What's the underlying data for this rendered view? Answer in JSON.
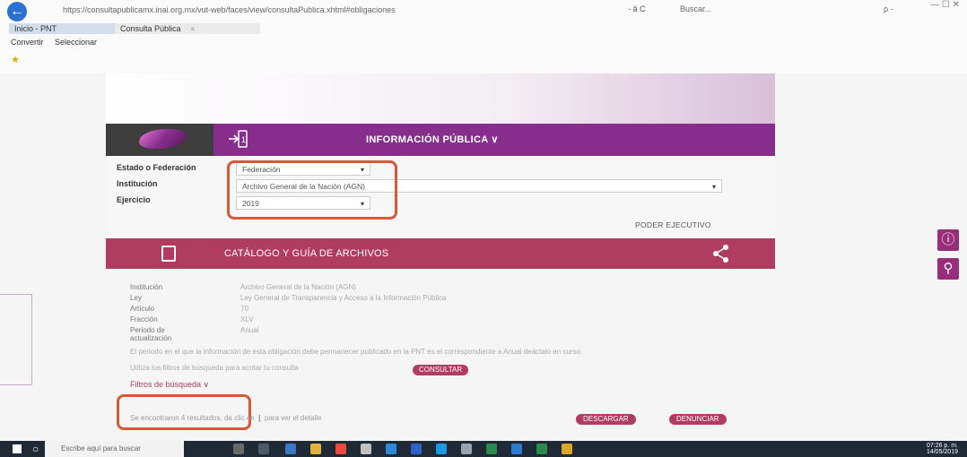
{
  "browser": {
    "back_icon": "back-arrow-icon",
    "url": "https://consultapublicamx.inai.org.mx/vut-web/faces/view/consultaPublica.xhtml#obligaciones",
    "url_tools": "- â C",
    "search_placeholder": "Buscar...",
    "search_right": "ρ -",
    "window_controls": "—   ☐   ✕",
    "tabs": [
      {
        "label": "Inicio - PNT"
      },
      {
        "label": "Consulta Pública"
      }
    ],
    "toolbar_items": [
      "Convertir",
      "Seleccionar"
    ]
  },
  "nav": {
    "title": "INFORMACIÓN PÚBLICA ∨"
  },
  "form": {
    "labels": {
      "estado": "Estado o Federación",
      "institucion": "Institución",
      "ejercicio": "Ejercicio"
    },
    "values": {
      "estado": "Federación",
      "institucion": "Archivo General de la Nación (AGN)",
      "ejercicio": "2019"
    },
    "poder": "PODER EJECUTIVO"
  },
  "catalog": {
    "title": "CATÁLOGO Y GUÍA DE ARCHIVOS"
  },
  "details": {
    "rows": [
      {
        "label": "Institución",
        "value": "Archivo General de la Nación (AGN)"
      },
      {
        "label": "Ley",
        "value": "Ley General de Transparencia y Acceso a la Información Pública"
      },
      {
        "label": "Artículo",
        "value": "70"
      },
      {
        "label": "Fracción",
        "value": "XLV"
      },
      {
        "label": "Periodo de actualización",
        "value": "Anual"
      }
    ],
    "period_note": "El periodo en el que la información de esta obligación debe permanecer publicado en la PNT es el correspondiente a Anual deáctalo en curso.",
    "filter_hint": "Utiliza los filtros de búsqueda para acotar tu consulta",
    "consultar_label": "CONSULTAR",
    "filtros_label": "Filtros de búsqueda ∨",
    "result_text": "Se encontraron 4 resultados, da clic en ❙ para ver el detalle",
    "descargar_label": "DESCARGAR",
    "denunciar_label": "DENUNCIAR"
  },
  "side_tools": [
    "alert-icon",
    "wrench-icon"
  ],
  "taskbar": {
    "search_placeholder": "Escribe aquí para buscar",
    "time": "07:26 p. m.",
    "date": "14/05/2019"
  }
}
